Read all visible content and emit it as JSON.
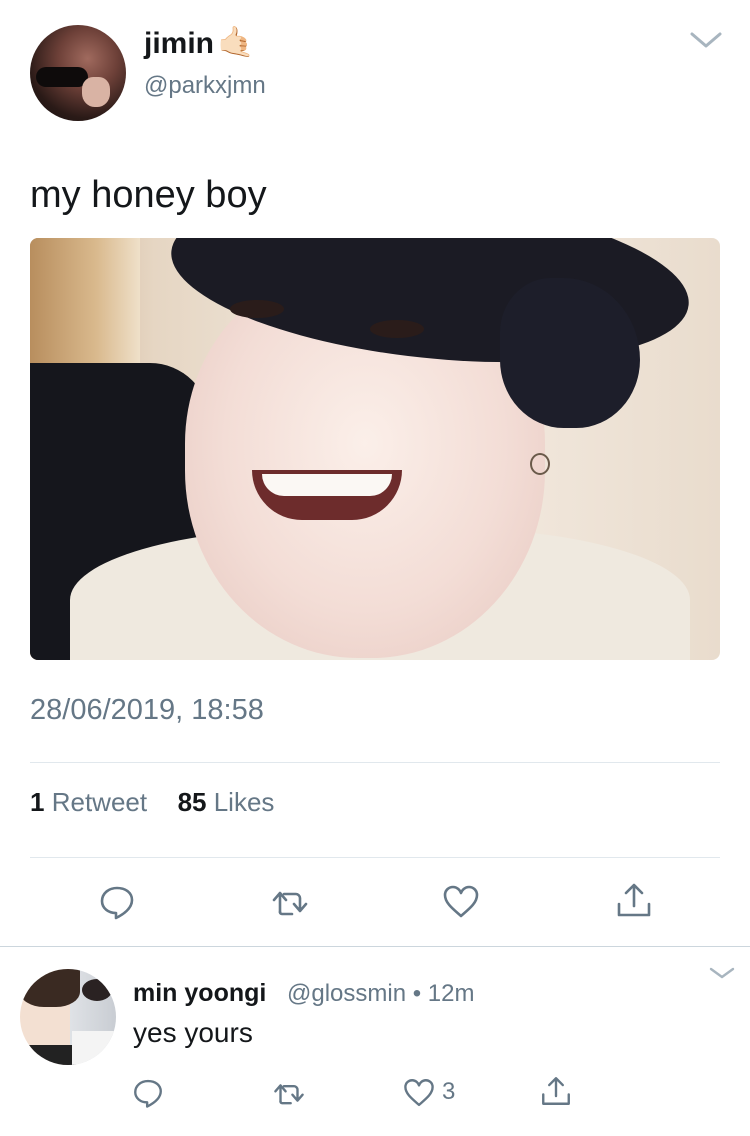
{
  "tweet": {
    "display_name": "jimin",
    "name_emoji": "🤙🏻",
    "handle": "@parkxjmn",
    "text": "my honey boy",
    "timestamp": "28/06/2019, 18:58",
    "stats": {
      "retweets_count": "1",
      "retweets_label": "Retweet",
      "likes_count": "85",
      "likes_label": "Likes"
    },
    "actions": [
      "reply-icon",
      "retweet-icon",
      "like-icon",
      "share-icon"
    ]
  },
  "reply": {
    "display_name": "min yoongi",
    "meta": "@glossmin • 12m",
    "text": "yes yours",
    "like_count": "3",
    "actions": [
      "reply-icon",
      "retweet-icon",
      "like-icon",
      "share-icon"
    ]
  },
  "colors": {
    "text_primary": "#14171a",
    "text_secondary": "#657786",
    "divider": "#e1e8ed",
    "icon": "#657786"
  }
}
